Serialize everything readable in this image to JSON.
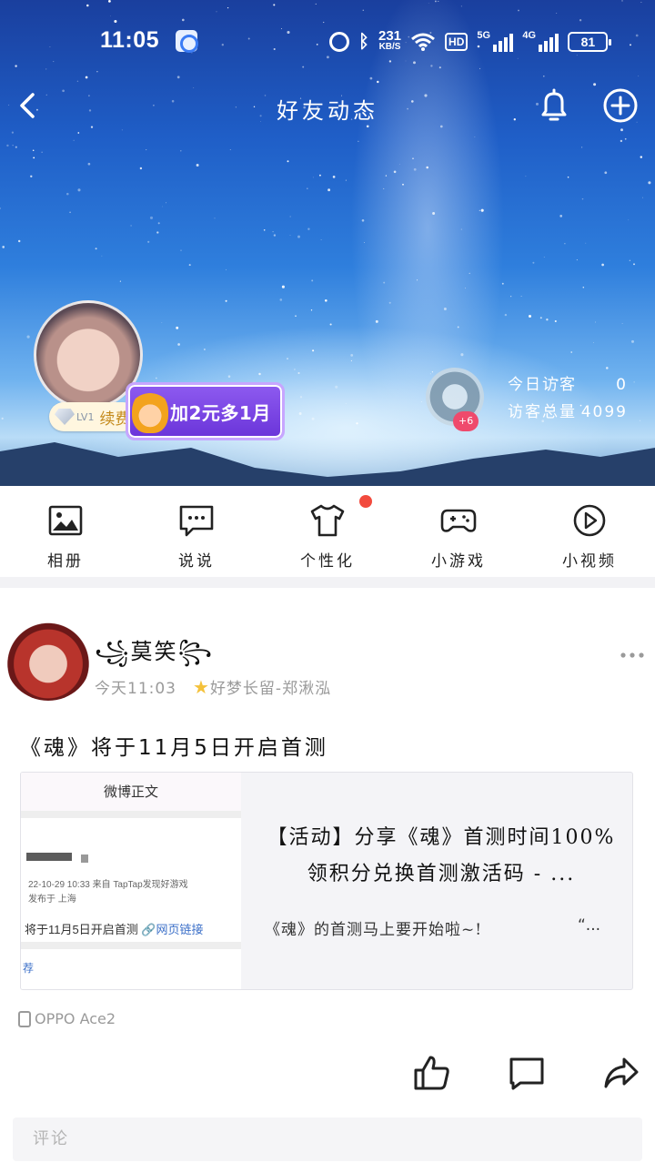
{
  "status_bar": {
    "time": "11:05",
    "net_speed": "231",
    "net_speed_unit": "KB/S",
    "hd_label": "HD",
    "sim1_label": "5G",
    "sim2_label": "4G",
    "battery": "81"
  },
  "navbar": {
    "title": "好友动态",
    "icons": [
      "back-icon",
      "bell-icon",
      "add-icon"
    ]
  },
  "profile": {
    "level": "LV1",
    "renew_label": "续费",
    "promo_text": "加2元多1月",
    "visitor_extra": "+6",
    "visits_today_label": "今日访客",
    "visits_today": "0",
    "visits_total_label": "访客总量",
    "visits_total": "4099"
  },
  "tools": [
    {
      "label": "相册",
      "icon": "album-icon"
    },
    {
      "label": "说说",
      "icon": "chat-icon"
    },
    {
      "label": "个性化",
      "icon": "shirt-icon"
    },
    {
      "label": "小游戏",
      "icon": "gamepad-icon"
    },
    {
      "label": "小视频",
      "icon": "play-icon"
    }
  ],
  "post": {
    "author": "莫笑",
    "time": "今天11:03",
    "relation": "好梦长留-郑湫泓",
    "text": "《魂》将于11月5日开启首测",
    "card": {
      "thumb_header": "微博正文",
      "thumb_date": "22-10-29 10:33  来自 TapTap发现好游戏",
      "thumb_location": "发布于 上海",
      "thumb_main": "将于11月5日开启首测",
      "thumb_link": "🔗网页链接",
      "thumb_rec": "荐",
      "title": "【活动】分享《魂》首测时间100%领积分兑换首测激活码 - ...",
      "desc": "《魂》的首测马上要开始啦~!",
      "desc_tail": "“..."
    },
    "device": "OPPO Ace2",
    "actions": [
      "like-icon",
      "comment-icon",
      "share-icon"
    ]
  },
  "comment": {
    "placeholder": "评论"
  }
}
